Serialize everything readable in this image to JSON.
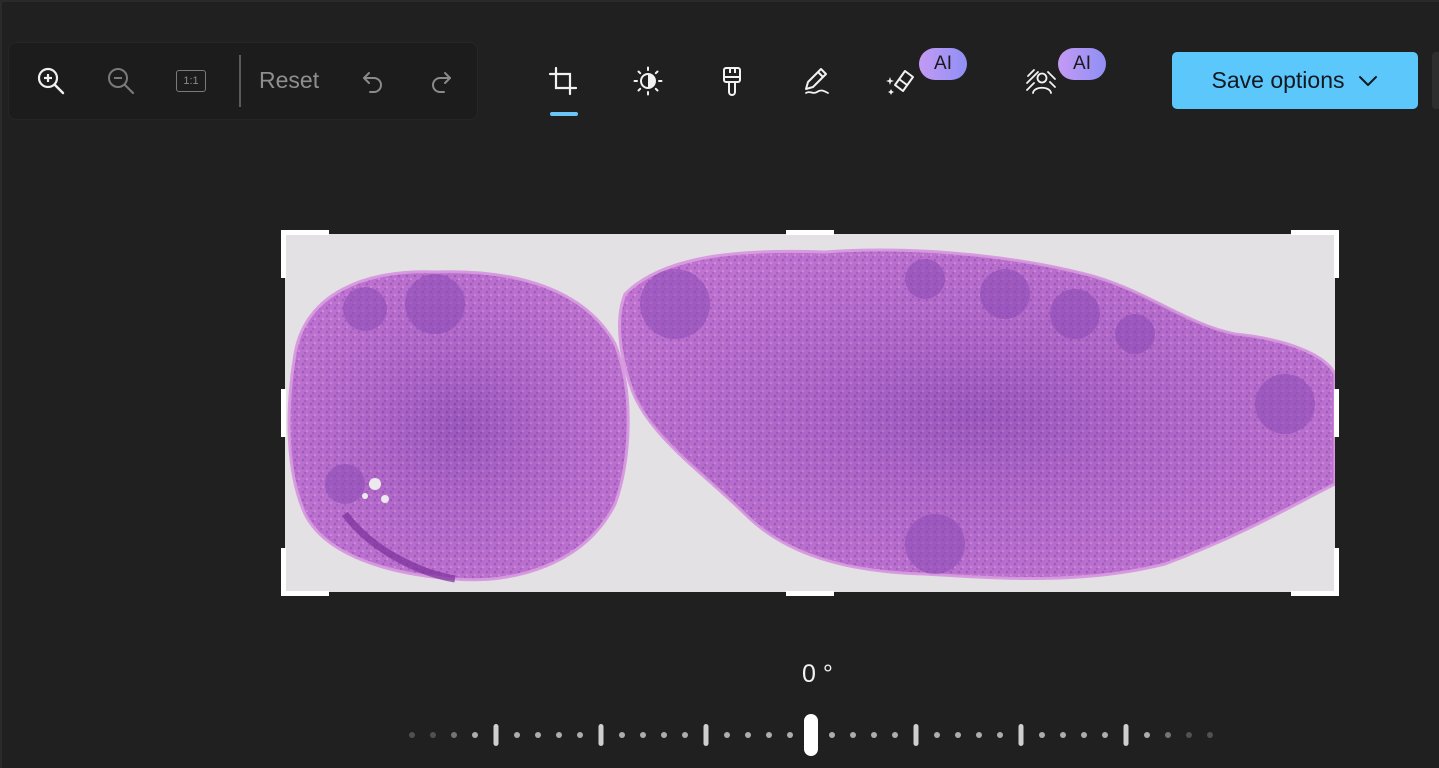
{
  "toolbar": {
    "zoom_in": "zoom-in-icon",
    "zoom_out": "zoom-out-icon",
    "actual_size_label": "1:1",
    "reset_label": "Reset",
    "undo": "undo-icon",
    "redo": "redo-icon"
  },
  "tools": [
    {
      "name": "crop",
      "icon": "crop-icon",
      "active": true
    },
    {
      "name": "adjust",
      "icon": "brightness-icon"
    },
    {
      "name": "filter",
      "icon": "brush-icon"
    },
    {
      "name": "markup",
      "icon": "pen-icon"
    },
    {
      "name": "erase",
      "icon": "eraser-icon",
      "badge": "AI"
    },
    {
      "name": "background",
      "icon": "background-blur-icon",
      "badge": "AI"
    }
  ],
  "save": {
    "label": "Save options",
    "icon": "chevron-down-icon"
  },
  "rotation": {
    "angle_text": "0 °",
    "value": 0
  },
  "colors": {
    "background": "#202020",
    "accent": "#5cc7fb",
    "ai_badge_start": "#c49af4",
    "ai_badge_end": "#8f8ff5",
    "tissue": "#b05fcb",
    "slide": "#e2e0e2"
  }
}
